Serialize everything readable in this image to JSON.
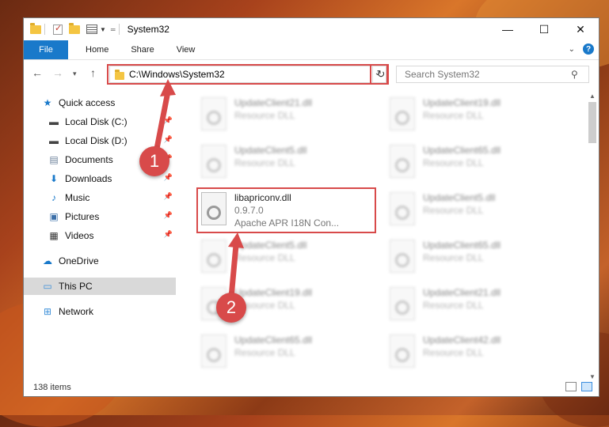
{
  "window": {
    "title": "System32",
    "controls": {
      "minimize": "—",
      "maximize": "☐",
      "close": "✕"
    }
  },
  "ribbon": {
    "tabs": [
      "File",
      "Home",
      "Share",
      "View"
    ],
    "help": "?"
  },
  "address": {
    "path": "C:\\Windows\\System32",
    "search_placeholder": "Search System32"
  },
  "sidebar": {
    "items": [
      {
        "label": "Quick access",
        "icon": "star-icon",
        "pinned": false
      },
      {
        "label": "Local Disk (C:)",
        "icon": "drive-icon",
        "pinned": true
      },
      {
        "label": "Local Disk (D:)",
        "icon": "drive-icon",
        "pinned": true
      },
      {
        "label": "Documents",
        "icon": "documents-icon",
        "pinned": true
      },
      {
        "label": "Downloads",
        "icon": "download-icon",
        "pinned": true
      },
      {
        "label": "Music",
        "icon": "music-icon",
        "pinned": true
      },
      {
        "label": "Pictures",
        "icon": "pictures-icon",
        "pinned": true
      },
      {
        "label": "Videos",
        "icon": "videos-icon",
        "pinned": true
      },
      {
        "label": "OneDrive",
        "icon": "cloud-icon",
        "pinned": false
      },
      {
        "label": "This PC",
        "icon": "computer-icon",
        "pinned": false
      },
      {
        "label": "Network",
        "icon": "network-icon",
        "pinned": false
      }
    ]
  },
  "files": {
    "highlighted": {
      "name": "libapriconv.dll",
      "version": "0.9.7.0",
      "description": "Apache APR I18N Con..."
    },
    "blurred": [
      {
        "name": "UpdateClient21.dll",
        "type": "Resource DLL"
      },
      {
        "name": "UpdateClient19.dll",
        "type": "Resource DLL"
      },
      {
        "name": "UpdateClient5.dll",
        "type": "Resource DLL"
      },
      {
        "name": "UpdateClient65.dll",
        "type": "Resource DLL"
      },
      {
        "name": "UpdateClient5.dll",
        "type": "Resource DLL"
      },
      {
        "name": "UpdateClient5.dll",
        "type": "Resource DLL"
      },
      {
        "name": "UpdateClient65.dll",
        "type": "Resource DLL"
      },
      {
        "name": "UpdateClient19.dll",
        "type": "Resource DLL"
      },
      {
        "name": "UpdateClient21.dll",
        "type": "Resource DLL"
      },
      {
        "name": "UpdateClient65.dll",
        "type": "Resource DLL"
      },
      {
        "name": "UpdateClient42.dll",
        "type": "Resource DLL"
      }
    ]
  },
  "status": {
    "count": "138 items"
  },
  "callouts": [
    "1",
    "2"
  ],
  "colors": {
    "accent": "#1979ca",
    "highlight": "#d84a4a",
    "selected": "#d9d9d9"
  }
}
